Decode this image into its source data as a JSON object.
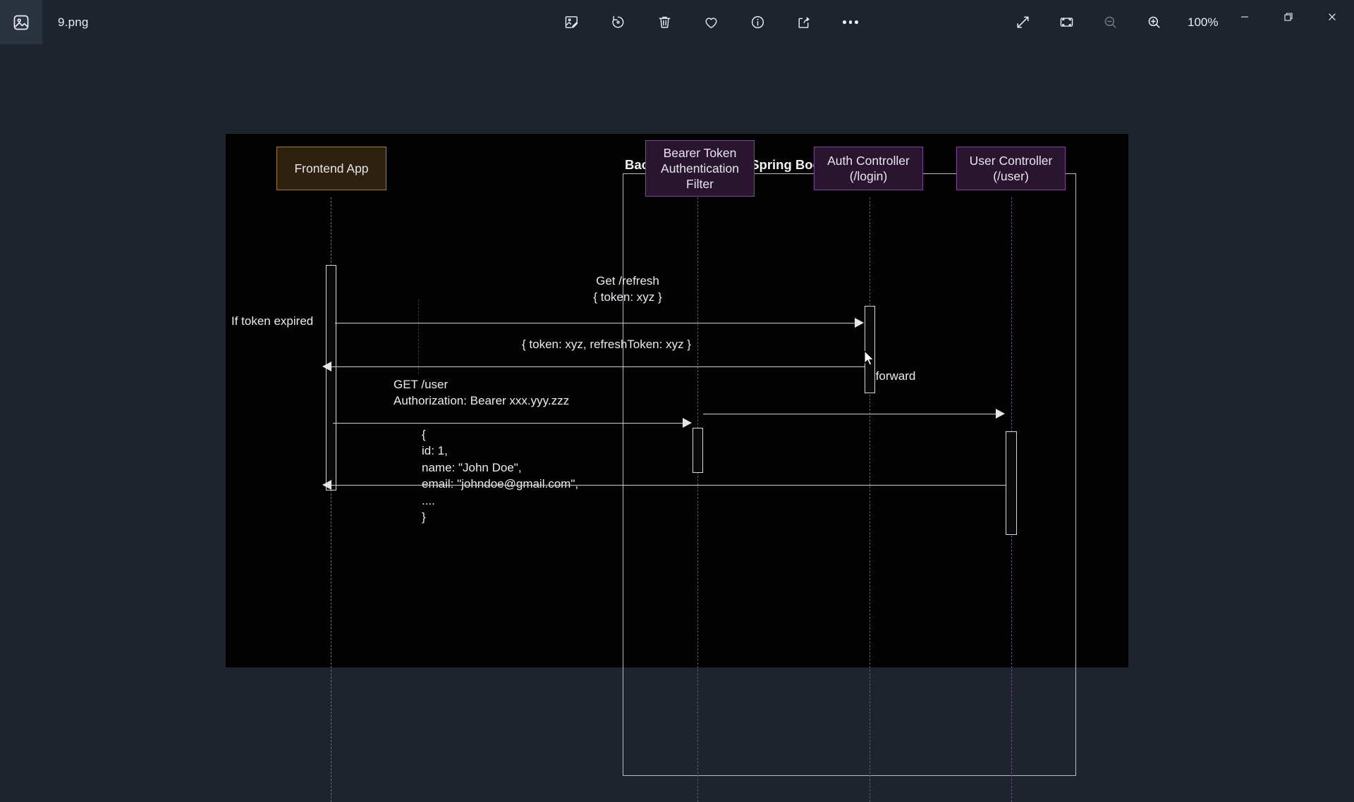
{
  "window": {
    "file_title": "9.png",
    "app_icon": "photos-app-icon"
  },
  "toolbar": {
    "center_buttons": [
      {
        "name": "edit-image-icon",
        "label": "Edit image"
      },
      {
        "name": "rotate-icon",
        "label": "Rotate"
      },
      {
        "name": "delete-icon",
        "label": "Delete"
      },
      {
        "name": "favorite-heart-icon",
        "label": "Add to favorites"
      },
      {
        "name": "info-icon",
        "label": "File info"
      },
      {
        "name": "share-icon",
        "label": "Share"
      },
      {
        "name": "more-options-icon",
        "label": "See more"
      }
    ],
    "right_buttons": [
      {
        "name": "fullscreen-icon",
        "label": "Full screen"
      },
      {
        "name": "fit-to-window-icon",
        "label": "Fit to window"
      },
      {
        "name": "zoom-out-icon",
        "label": "Zoom out"
      },
      {
        "name": "zoom-in-icon",
        "label": "Zoom in"
      }
    ],
    "zoom_level": "100%"
  },
  "window_controls": {
    "minimize": "Minimize",
    "maximize": "Restore",
    "close": "Close"
  },
  "diagram": {
    "type": "sequence-diagram",
    "group_title": "Backend REST API (Spring Boot)",
    "participants": [
      {
        "id": "frontend",
        "label": "Frontend App",
        "kind": "frontend",
        "fill": "#2e2110",
        "border": "#a4793d"
      },
      {
        "id": "filter",
        "label": "Bearer Token\nAuthentication\nFilter",
        "kind": "participant",
        "fill": "#2a1530",
        "border": "#7f4596"
      },
      {
        "id": "auth",
        "label": "Auth Controller\n(/login)",
        "kind": "participant",
        "fill": "#2a1530",
        "border": "#7f4596"
      },
      {
        "id": "user",
        "label": "User Controller\n(/user)",
        "kind": "participant",
        "fill": "#2a1530",
        "border": "#7f4596"
      }
    ],
    "fragment_label": "If token expired",
    "messages": [
      {
        "id": "m1",
        "text": "Get   /refresh\n{ token: xyz }",
        "from": "frontend",
        "to": "auth",
        "direction": "right"
      },
      {
        "id": "m2",
        "text": "{ token: xyz, refreshToken: xyz }",
        "from": "auth",
        "to": "frontend",
        "direction": "left"
      },
      {
        "id": "m3",
        "text": "GET /user\nAuthorization: Bearer xxx.yyy.zzz",
        "from": "frontend",
        "to": "filter",
        "direction": "right"
      },
      {
        "id": "m4",
        "text": "forward",
        "from": "filter",
        "to": "user",
        "direction": "right"
      },
      {
        "id": "m5",
        "text": "{\n    id: 1,\n    name: \"John Doe\",\n    email: \"johndoe@gmail.com\",\n    ....\n}",
        "from": "user",
        "to": "frontend",
        "direction": "left"
      }
    ],
    "colors": {
      "canvas_background": "#030303",
      "message_line": "#cfcfcf",
      "activation_border": "#d8d8d8",
      "group_frame": "#b9bcc4",
      "text": "#eceaf0"
    }
  }
}
